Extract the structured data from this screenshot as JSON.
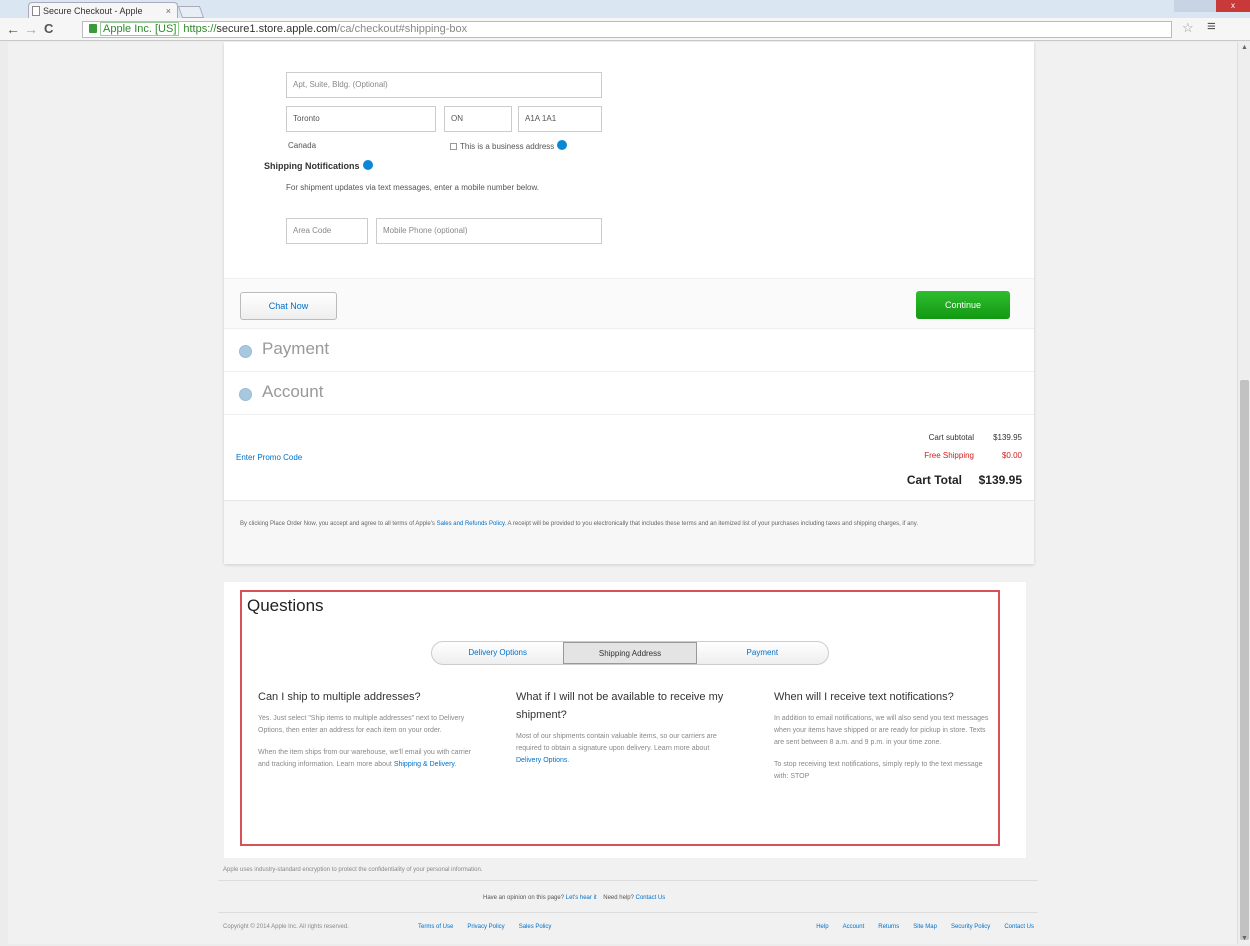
{
  "browser": {
    "tab_title": "Secure Checkout - Apple",
    "tab_close": "×",
    "back": "←",
    "forward": "→",
    "reload": "C",
    "ev_label": "Apple Inc. [US]",
    "url_scheme": "https://",
    "url_host": "secure1.store.apple.com",
    "url_path": "/ca/checkout#shipping-box",
    "star_icon": "☆",
    "menu_icon": "≡",
    "window_close": "x"
  },
  "address": {
    "apt_placeholder": "Apt, Suite, Bldg. (Optional)",
    "city": "Toronto",
    "province": "ON",
    "postal": "A1A 1A1",
    "country": "Canada",
    "business_label": "This is a business address"
  },
  "notifications": {
    "title": "Shipping Notifications",
    "description": "For shipment updates via text messages, enter a mobile number below.",
    "area_code_placeholder": "Area Code",
    "mobile_placeholder": "Mobile Phone (optional)"
  },
  "actions": {
    "chat_label": "Chat Now",
    "continue_label": "Continue"
  },
  "steps": {
    "payment": "Payment",
    "account": "Account"
  },
  "summary": {
    "promo_link": "Enter Promo Code",
    "subtotal_label": "Cart subtotal",
    "subtotal_value": "$139.95",
    "shipping_label": "Free Shipping",
    "shipping_value": "$0.00",
    "total_label": "Cart Total",
    "total_value": "$139.95"
  },
  "legal": {
    "text_before": "By clicking Place Order Now, you accept and agree to all terms of Apple's",
    "link": "Sales and Refunds Policy",
    "text_after": ". A receipt will be provided to you electronically that includes these terms and an itemized list of your purchases including taxes and shipping charges, if any."
  },
  "questions": {
    "title": "Questions",
    "tabs": [
      "Delivery Options",
      "Shipping Address",
      "Payment"
    ],
    "col1": {
      "heading": "Can I ship to multiple addresses?",
      "p1": "Yes. Just select \"Ship items to multiple addresses\" next to Delivery Options, then enter an address for each item on your order.",
      "p2": "When the item ships from our warehouse, we'll email you with carrier and tracking information. Learn more about",
      "link": "Shipping & Delivery",
      "end": "."
    },
    "col2": {
      "heading": "What if I will not be available to receive my shipment?",
      "p1": "Most of our shipments contain valuable items, so our carriers are required to obtain a signature upon delivery. Learn more about",
      "link": "Delivery Options",
      "end": "."
    },
    "col3": {
      "heading": "When will I receive text notifications?",
      "p1": "In addition to email notifications, we will also send you text messages when your items have shipped or are ready for pickup in store. Texts are sent between 8 a.m. and 9 p.m. in your time zone.",
      "p2": "To stop receiving text notifications, simply reply to the text message with: STOP"
    }
  },
  "footer": {
    "security_note": "Apple uses industry-standard encryption to protect the confidentiality of your personal information.",
    "feedback_q": "Have an opinion on this page?",
    "feedback_link": "Let's hear it",
    "help_q": "Need help?",
    "help_link": "Contact Us",
    "copyright": "Copyright © 2014 Apple Inc. All rights reserved.",
    "links_left": [
      "Terms of Use",
      "Privacy Policy",
      "Sales Policy"
    ],
    "links_right": [
      "Help",
      "Account",
      "Returns",
      "Site Map",
      "Security Policy",
      "Contact Us"
    ]
  }
}
